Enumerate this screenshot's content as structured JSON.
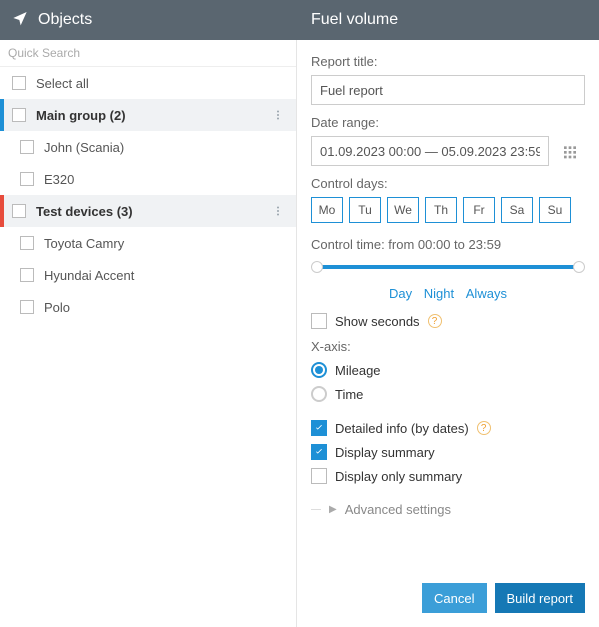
{
  "topbar": {
    "left": "Objects",
    "right": "Fuel volume"
  },
  "left": {
    "quick_search": "Quick Search",
    "select_all": "Select all",
    "groups": [
      {
        "label": "Main group (2)",
        "accent": "blue",
        "children": [
          "John (Scania)",
          "E320"
        ]
      },
      {
        "label": "Test devices (3)",
        "accent": "red",
        "children": [
          "Toyota Camry",
          "Hyundai Accent",
          "Polo"
        ]
      }
    ]
  },
  "right": {
    "report_title_label": "Report title:",
    "report_title_value": "Fuel report",
    "date_range_label": "Date range:",
    "date_range_value": "01.09.2023 00:00 — 05.09.2023 23:59",
    "control_days_label": "Control days:",
    "days": [
      "Mo",
      "Tu",
      "We",
      "Th",
      "Fr",
      "Sa",
      "Su"
    ],
    "control_time_label": "Control time: from 00:00 to 23:59",
    "modes": {
      "day": "Day",
      "night": "Night",
      "always": "Always"
    },
    "show_seconds": "Show seconds",
    "xaxis_label": "X-axis:",
    "xaxis_mileage": "Mileage",
    "xaxis_time": "Time",
    "detailed_info": "Detailed info (by dates)",
    "display_summary": "Display summary",
    "display_only_summary": "Display only summary",
    "advanced": "Advanced settings",
    "cancel": "Cancel",
    "build": "Build report"
  }
}
